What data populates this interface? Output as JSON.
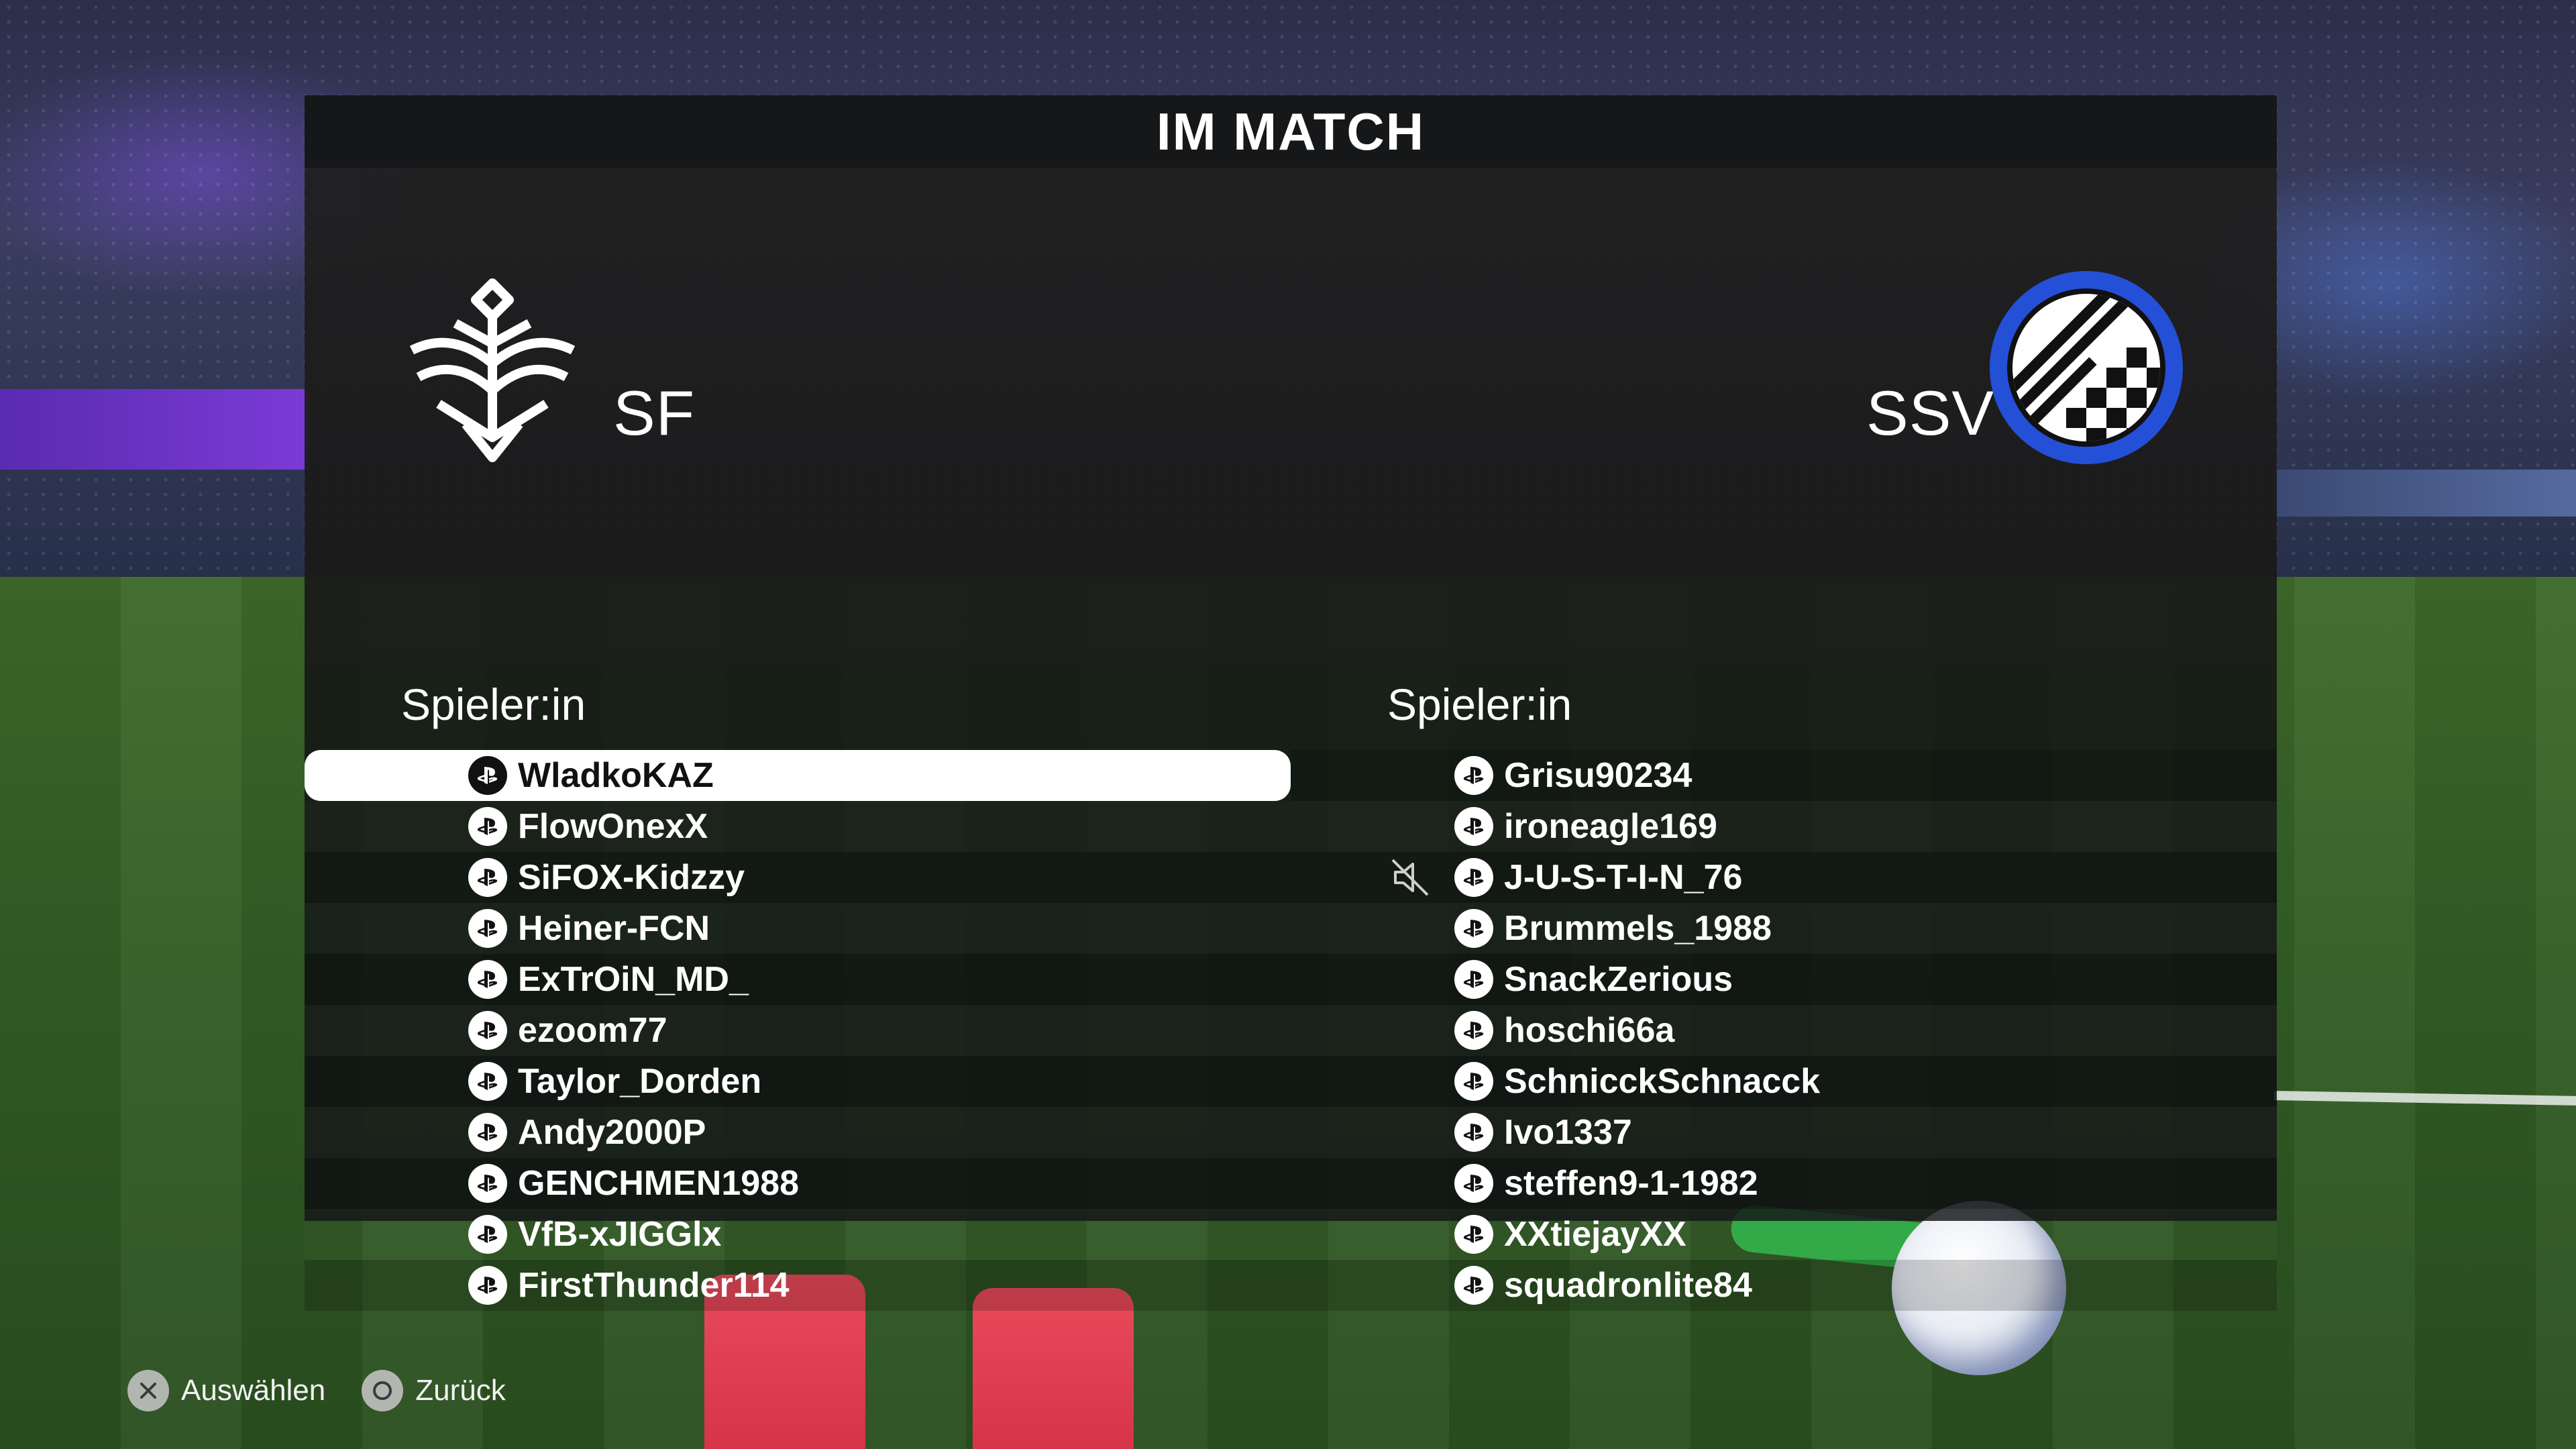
{
  "title": "IM MATCH",
  "home_team": {
    "name": "SF",
    "column_header": "Spieler:in",
    "players": [
      {
        "name": "WladkoKAZ",
        "selected": true
      },
      {
        "name": "FlowOnexX"
      },
      {
        "name": "SiFOX-Kidzzy"
      },
      {
        "name": "Heiner-FCN"
      },
      {
        "name": "ExTrOiN_MD_"
      },
      {
        "name": "ezoom77"
      },
      {
        "name": "Taylor_Dorden"
      },
      {
        "name": "Andy2000P"
      },
      {
        "name": "GENCHMEN1988"
      },
      {
        "name": "VfB-xJIGGlx"
      },
      {
        "name": "FirstThunder114"
      }
    ]
  },
  "away_team": {
    "name": "SSV",
    "column_header": "Spieler:in",
    "players": [
      {
        "name": "Grisu90234"
      },
      {
        "name": "ironeagle169"
      },
      {
        "name": "J-U-S-T-I-N_76",
        "muted": true
      },
      {
        "name": "Brummels_1988"
      },
      {
        "name": "SnackZerious"
      },
      {
        "name": "hoschi66a"
      },
      {
        "name": "SchnicckSchnacck"
      },
      {
        "name": "Ivo1337"
      },
      {
        "name": "steffen9-1-1982"
      },
      {
        "name": "XXtiejayXX"
      },
      {
        "name": "squadronlite84"
      }
    ]
  },
  "footer": {
    "select_label": "Auswählen",
    "back_label": "Zurück",
    "select_icon": "cross-button-icon",
    "back_icon": "circle-button-icon"
  },
  "icons": {
    "platform": "playstation-icon",
    "mute": "speaker-muted-icon"
  }
}
